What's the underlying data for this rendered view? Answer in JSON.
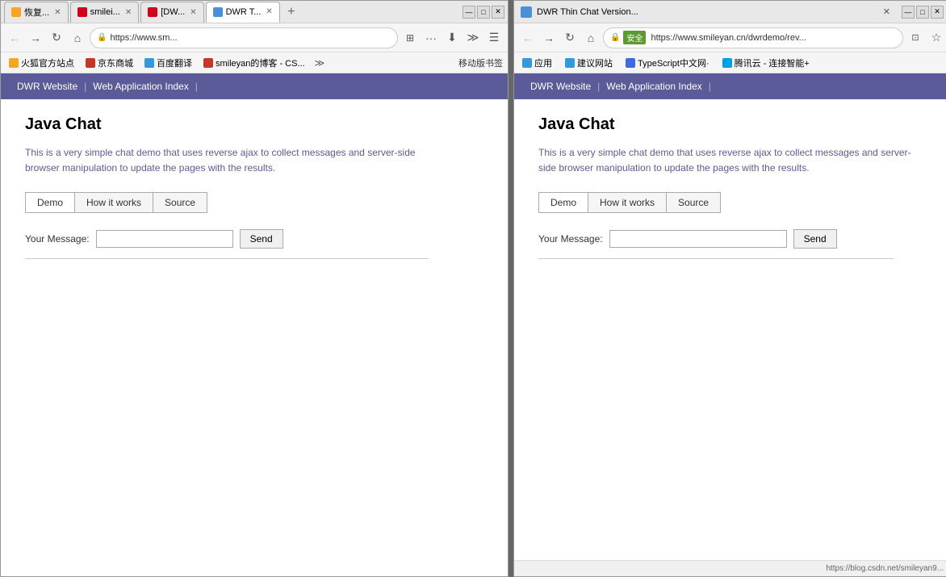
{
  "left_browser": {
    "title": "DWR T...",
    "tabs": [
      {
        "id": "tab1",
        "label": "恢复...",
        "icon_color": "yellow",
        "active": false
      },
      {
        "id": "tab2",
        "label": "smilei...",
        "icon_color": "red",
        "active": false
      },
      {
        "id": "tab3",
        "label": "[DW...",
        "icon_color": "red",
        "active": false
      },
      {
        "id": "tab4",
        "label": "DWR T...",
        "icon_color": "blue",
        "active": true
      }
    ],
    "address": "https://www.sm...",
    "bookmarks": [
      {
        "label": "火狐官方站点",
        "color": "bk-orange"
      },
      {
        "label": "京东商城",
        "color": "bk-red"
      },
      {
        "label": "百度翻译",
        "color": "bk-blue"
      },
      {
        "label": "smileyan的博客 - CS...",
        "color": "bk-red"
      }
    ],
    "mobile_label": "移动版书签",
    "dwr_nav": {
      "link1": "DWR Website",
      "sep": "|",
      "link2": "Web Application Index",
      "sep2": "|"
    },
    "page": {
      "title": "Java Chat",
      "description": "This is a very simple chat demo that uses reverse ajax to collect messages and server-side browser manipulation to update the pages with the results.",
      "tabs": [
        "Demo",
        "How it works",
        "Source"
      ],
      "active_tab": "Demo",
      "form_label": "Your Message:",
      "form_placeholder": "",
      "send_button": "Send"
    }
  },
  "right_browser": {
    "title": "DWR Thin Chat Version...",
    "address": "https://www.smileyan.cn/dwrdemo/rev...",
    "security_label": "安全",
    "bookmarks_bar": [
      {
        "label": "应用",
        "color": "bk-blue"
      },
      {
        "label": "建议网站",
        "color": "bk-blue"
      },
      {
        "label": "TypeScript中文网·",
        "color": "bk-blue"
      },
      {
        "label": "腾讯云 - 连接智能+",
        "color": "bk-blue"
      }
    ],
    "dwr_nav": {
      "link1": "DWR Website",
      "sep": "|",
      "link2": "Web Application Index",
      "sep2": "|"
    },
    "page": {
      "title": "Java Chat",
      "description": "This is a very simple chat demo that uses reverse ajax to collect messages and server-side browser manipulation to update the pages with the results.",
      "tabs": [
        "Demo",
        "How it works",
        "Source"
      ],
      "active_tab": "Demo",
      "form_label": "Your Message:",
      "form_placeholder": "",
      "send_button": "Send"
    },
    "status_url": "https://blog.csdn.net/smileyan9..."
  },
  "splitter_color": "#666"
}
